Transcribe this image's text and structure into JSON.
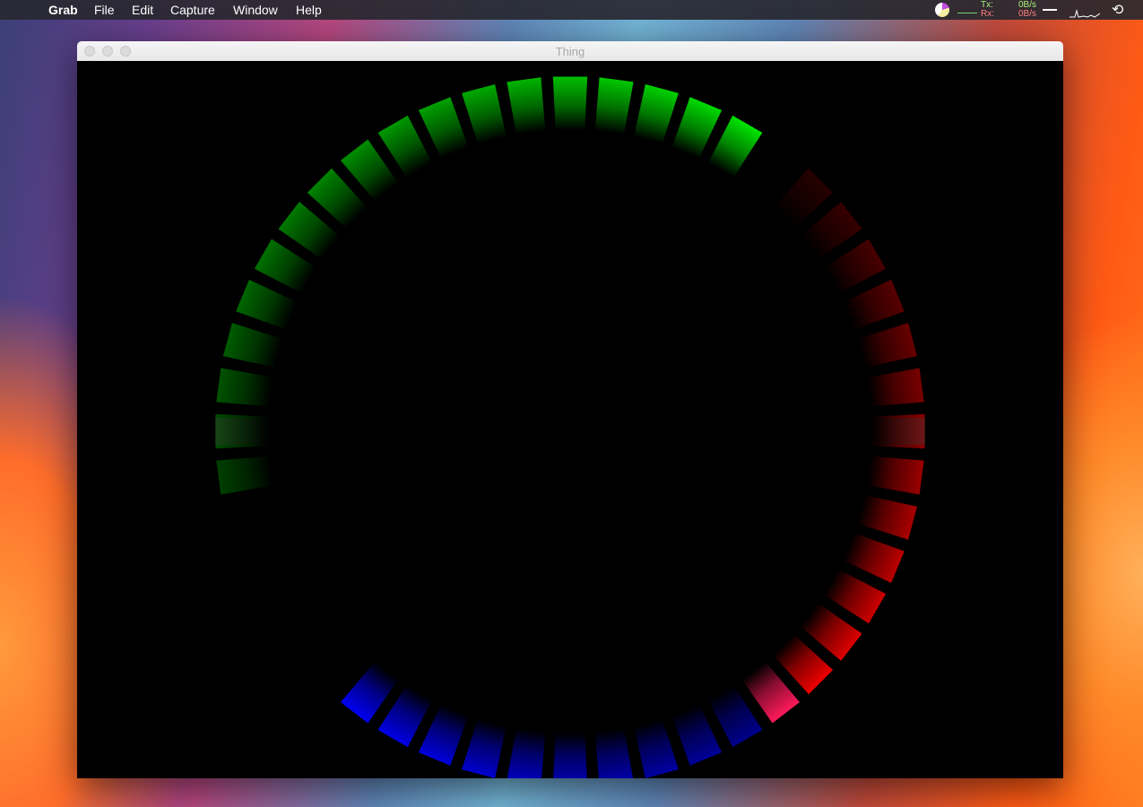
{
  "menubar": {
    "apple": "",
    "app": "Grab",
    "items": [
      "File",
      "Edit",
      "Capture",
      "Window",
      "Help"
    ]
  },
  "status": {
    "tx_label": "Tx:",
    "rx_label": "Rx:",
    "tx_value": "0B/s",
    "rx_value": "0B/s"
  },
  "window": {
    "title": "Thing"
  },
  "colors": {
    "green": "#00ff00",
    "blue": "#0000ff",
    "red": "#ff0000",
    "red_lead": "#ff1a5a",
    "gray": "#404040"
  },
  "ring": {
    "segments": 48,
    "arcs": [
      {
        "name": "green",
        "from_index": -13,
        "to_index": 4,
        "color": "#00ff00",
        "head_index": 4,
        "head_brightness": 0.9,
        "tail_brightness": 0.25
      },
      {
        "name": "blue",
        "from_index": -19,
        "to_index": -28,
        "color": "#0000ff",
        "head_index": -19,
        "head_brightness": 0.95,
        "tail_brightness": 0.55
      },
      {
        "name": "red",
        "from_index": -29,
        "to_index": -42,
        "color": "#ff0000",
        "head_index": -29,
        "head_brightness": 1.0,
        "tail_brightness": 0.15
      }
    ]
  }
}
